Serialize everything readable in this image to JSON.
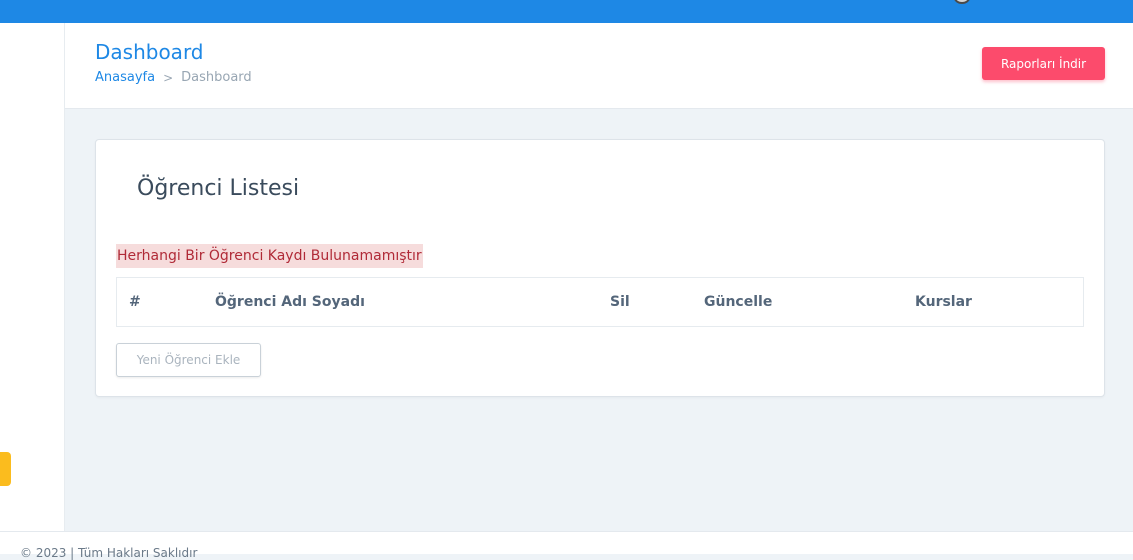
{
  "header": {
    "title": "Dashboard",
    "breadcrumb": {
      "home": "Anasayfa",
      "separator": ">",
      "current": "Dashboard"
    },
    "report_button": "Raporları İndir"
  },
  "card": {
    "title": "Öğrenci Listesi",
    "alert": "Herhangi Bir Öğrenci Kaydı Bulunamamıştır",
    "table": {
      "columns": [
        "#",
        "Öğrenci Adı Soyadı",
        "Sil",
        "Güncelle",
        "Kurslar"
      ],
      "rows": []
    },
    "add_button": "Yeni Öğrenci Ekle"
  },
  "footer": {
    "text": "© 2023 | Tüm Hakları Saklıdır"
  },
  "colors": {
    "primary": "#1e88e5",
    "danger": "#fc4b6c",
    "warning": "#fbbc1e",
    "alert_bg": "#f6dcdc",
    "alert_text": "#b02a37"
  }
}
